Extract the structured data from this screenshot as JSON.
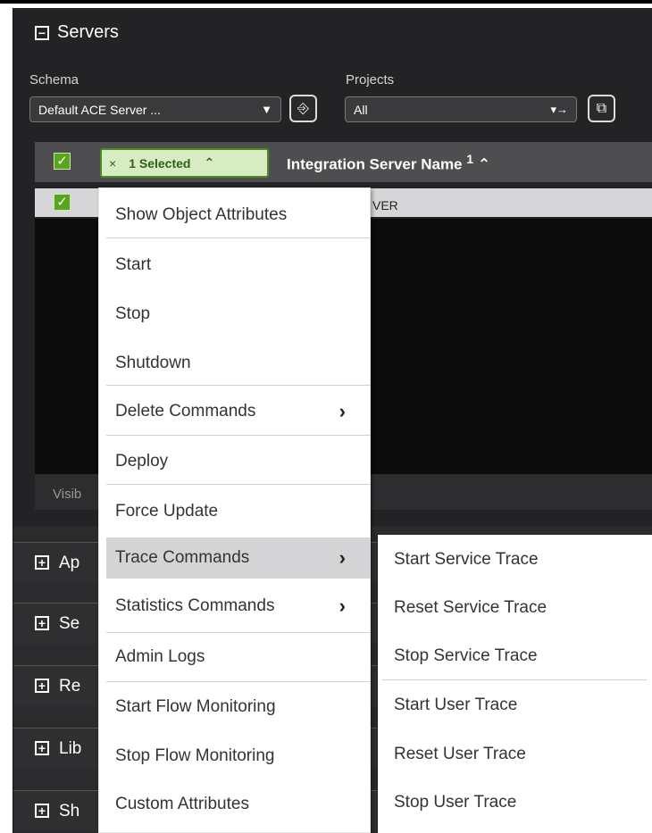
{
  "servers_panel": {
    "title": "Servers",
    "schema_label": "Schema",
    "schema_value": "Default ACE Server ...",
    "projects_label": "Projects",
    "projects_value": "All",
    "selected_count": "1 Selected",
    "column_header": "Integration Server Name",
    "sort_indicator": "1",
    "row_partial": "VER",
    "footer_partial": "Visib"
  },
  "collapsed_panels": [
    {
      "label": "Ap"
    },
    {
      "label": "Se"
    },
    {
      "label": "Re"
    },
    {
      "label": "Lib"
    },
    {
      "label": "Sh"
    }
  ],
  "context_menu": {
    "items": [
      {
        "label": "Show Object Attributes"
      },
      {
        "label": "Start"
      },
      {
        "label": "Stop"
      },
      {
        "label": "Shutdown"
      },
      {
        "label": "Delete Commands",
        "has_submenu": true
      },
      {
        "label": "Deploy"
      },
      {
        "label": "Force Update"
      },
      {
        "label": "Trace Commands",
        "has_submenu": true,
        "active": true
      },
      {
        "label": "Statistics Commands",
        "has_submenu": true
      },
      {
        "label": "Admin Logs"
      },
      {
        "label": "Start Flow Monitoring"
      },
      {
        "label": "Stop Flow Monitoring"
      },
      {
        "label": "Custom Attributes"
      }
    ]
  },
  "trace_submenu": {
    "items": [
      {
        "label": "Start Service Trace"
      },
      {
        "label": "Reset Service Trace"
      },
      {
        "label": "Stop Service Trace"
      },
      {
        "label": "Start User Trace"
      },
      {
        "label": "Reset User Trace"
      },
      {
        "label": "Stop User Trace"
      }
    ]
  },
  "icons": {
    "collapse": "minus-square-icon",
    "expand": "plus-square-icon",
    "checkbox": "checkmark-icon",
    "dropdown": "caret-down-icon",
    "arrow": "chevron-right-icon"
  },
  "colors": {
    "panel_background": "#232325",
    "selected_green": "#5aa51f",
    "menu_active": "#d4d4d7"
  }
}
